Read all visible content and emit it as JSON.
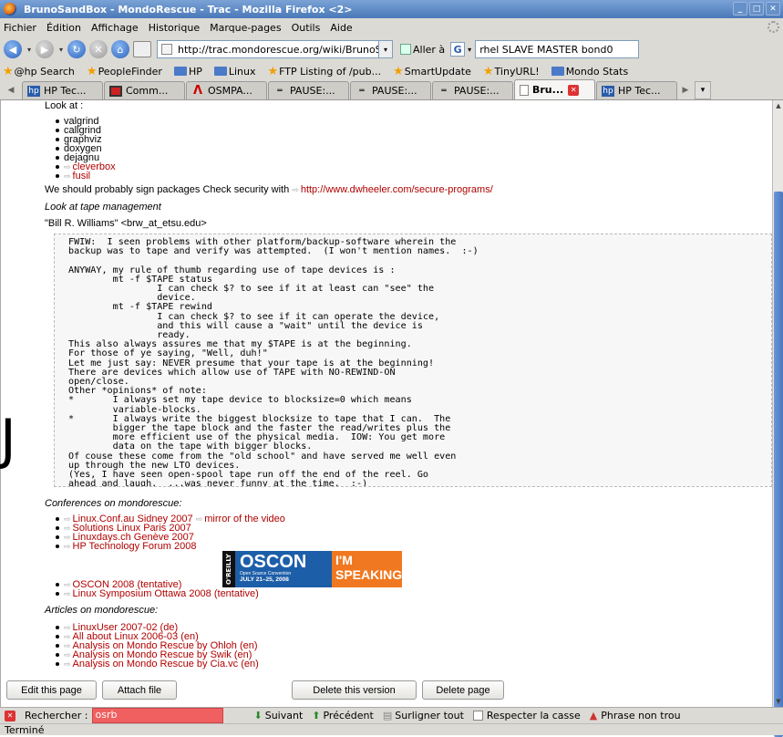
{
  "window": {
    "title": "BrunoSandBox - MondoRescue - Trac - Mozilla Firefox <2>"
  },
  "menu": [
    "Fichier",
    "Édition",
    "Affichage",
    "Historique",
    "Marque-pages",
    "Outils",
    "Aide"
  ],
  "nav": {
    "url": "http://trac.mondorescue.org/wiki/BrunoSandBo",
    "goto_label": "Aller à",
    "search_engine": "G",
    "search_value": "rhel SLAVE MASTER bond0"
  },
  "bookmarks": [
    "@hp Search",
    "PeopleFinder",
    "HP",
    "Linux",
    "FTP Listing of /pub...",
    "SmartUpdate",
    "TinyURL!",
    "Mondo Stats"
  ],
  "tabs": [
    {
      "label": "HP Tec...",
      "icon": "hp-icon",
      "active": false
    },
    {
      "label": "Comm...",
      "icon": "red-square-icon",
      "active": false
    },
    {
      "label": "OSMPA...",
      "icon": "red-lambda-icon",
      "active": false
    },
    {
      "label": "PAUSE:...",
      "icon": "pause-icon",
      "active": false
    },
    {
      "label": "PAUSE:...",
      "icon": "pause-icon",
      "active": false
    },
    {
      "label": "PAUSE:...",
      "icon": "pause-icon",
      "active": false
    },
    {
      "label": "Bru...",
      "icon": "page-icon",
      "active": true
    },
    {
      "label": "HP Tec...",
      "icon": "hp-icon",
      "active": false
    }
  ],
  "page": {
    "look_at": "Look at :",
    "tools": [
      "valgrind",
      "callgrind",
      "graphviz",
      "doxygen",
      "dejagnu"
    ],
    "tool_links": [
      "cleverbox",
      "fusil"
    ],
    "sign_text": "We should probably sign packages Check security with",
    "sign_link": "http://www.dwheeler.com/secure-programs/",
    "tape_heading": "Look at tape management",
    "author": "\"Bill R. Williams\" <brw_at_etsu.edu>",
    "pre": "FWIW:  I seen problems with other platform/backup-software wherein the\nbackup was to tape and verify was attempted.  (I won't mention names.  :-)\n\nANYWAY, my rule of thumb regarding use of tape devices is :\n        mt -f $TAPE status\n                I can check $? to see if it at least can \"see\" the\n                device.\n        mt -f $TAPE rewind\n                I can check $? to see if it can operate the device,\n                and this will cause a \"wait\" until the device is\n                ready.\nThis also always assures me that my $TAPE is at the beginning.\nFor those of ye saying, \"Well, duh!\"\nLet me just say: NEVER presume that your tape is at the beginning!\nThere are devices which allow use of TAPE with NO-REWIND-ON\nopen/close.\nOther *opinions* of note:\n*       I always set my tape device to blocksize=0 which means\n        variable-blocks.\n*       I always write the biggest blocksize to tape that I can.  The\n        bigger the tape block and the faster the read/writes plus the\n        more efficient use of the physical media.  IOW: You get more\n        data on the tape with bigger blocks.\nOf couse these come from the \"old school\" and have served me well even\nup through the new LTO devices.\n(Yes, I have seen open-spool tape run off the end of the reel. Go\nahead and laugh.  ...was never funny at the time.  :-)",
    "conf_heading": "Conferences on mondorescue:",
    "conf1": "Linux.Conf.au Sidney 2007",
    "conf1b": "mirror of the video",
    "conf2": "Solutions Linux Paris 2007",
    "conf3": "Linuxdays.ch Genève 2007",
    "conf4": "HP Technology Forum 2008",
    "oscon": {
      "oreilly": "O'REILLY",
      "name": "OSCON",
      "sub": "Open Source Convention",
      "dates": "JULY 21–25, 2008",
      "im": "I'M",
      "speaking": "SPEAKING"
    },
    "conf5": "OSCON 2008 (tentative)",
    "conf6": "Linux Symposium Ottawa 2008 (tentative)",
    "art_heading": "Articles on mondorescue:",
    "articles": [
      "LinuxUser 2007-02 (de)",
      "All about Linux 2006-03 (en)",
      "Analysis on Mondo Rescue by Ohloh (en)",
      "Analysis on Mondo Rescue by Swik (en)",
      "Analysis on Mondo Rescue by Cia.vc (en)"
    ],
    "buttons": {
      "edit": "Edit this page",
      "attach": "Attach file",
      "delete_version": "Delete this version",
      "delete_page": "Delete page"
    }
  },
  "left_glyph": "J",
  "find": {
    "label": "Rechercher :",
    "value": "osrb",
    "next": "Suivant",
    "prev": "Précédent",
    "highlight": "Surligner tout",
    "match_case": "Respecter la casse",
    "not_found": "Phrase non trou"
  },
  "status": "Terminé"
}
